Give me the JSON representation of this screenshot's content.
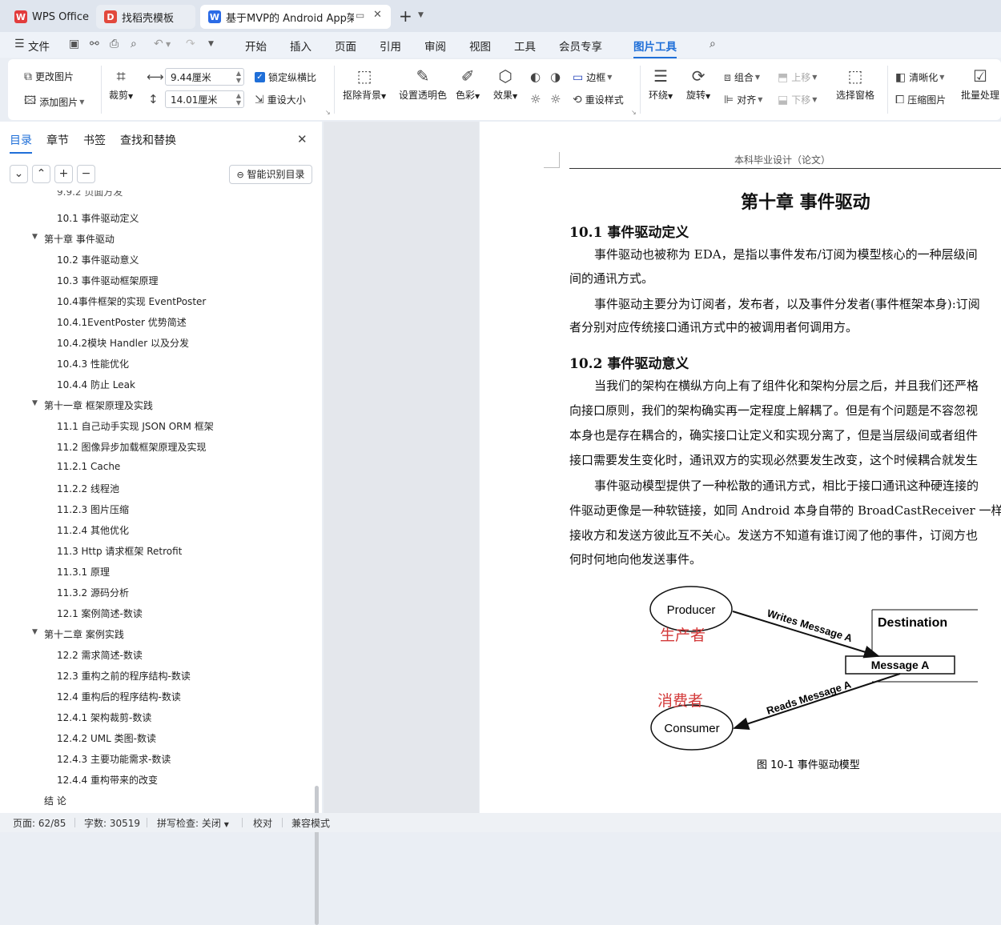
{
  "tabs": [
    {
      "label": "WPS Office",
      "icon": "W"
    },
    {
      "label": "找稻壳模板",
      "icon": "D"
    },
    {
      "label": "基于MVP的 Android App架构",
      "icon": "W"
    }
  ],
  "menu": {
    "file": "文件",
    "items": [
      "开始",
      "插入",
      "页面",
      "引用",
      "审阅",
      "视图",
      "工具",
      "会员专享",
      "图片工具"
    ]
  },
  "ribbon": {
    "change_picture": "更改图片",
    "add_picture": "添加图片",
    "crop": "裁剪",
    "width_value": "9.44厘米",
    "height_value": "14.01厘米",
    "lock_ratio": "锁定纵横比",
    "reset_size": "重设大小",
    "remove_bg": "抠除背景",
    "set_transparent": "设置透明色",
    "color": "色彩",
    "effect": "效果",
    "border": "边框",
    "reset_style": "重设样式",
    "wrap": "环绕",
    "rotate": "旋转",
    "group": "组合",
    "align": "对齐",
    "move_up": "上移",
    "move_down": "下移",
    "select_pane": "选择窗格",
    "sharpen": "清晰化",
    "compress": "压缩图片",
    "batch": "批量处理"
  },
  "sidebar": {
    "tabs": [
      "目录",
      "章节",
      "书签",
      "查找和替换"
    ],
    "smart_button": "智能识别目录",
    "partial": "9.9.2 页面方发",
    "items": [
      {
        "label": "10.1  事件驱动定义",
        "level": 2
      },
      {
        "label": "第十章  事件驱动",
        "level": 1
      },
      {
        "label": "10.2  事件驱动意义",
        "level": 2
      },
      {
        "label": "10.3  事件驱动框架原理",
        "level": 2
      },
      {
        "label": "10.4事件框架的实现 EventPoster",
        "level": 2
      },
      {
        "label": "10.4.1EventPoster 优势简述",
        "level": 2
      },
      {
        "label": "10.4.2模块 Handler 以及分发",
        "level": 2
      },
      {
        "label": "10.4.3 性能优化",
        "level": 2
      },
      {
        "label": "10.4.4  防止 Leak",
        "level": 2
      },
      {
        "label": "第十一章  框架原理及实践",
        "level": 1
      },
      {
        "label": "11.1   自己动手实现 JSON ORM   框架",
        "level": 2
      },
      {
        "label": "11.2   图像异步加载框架原理及实现",
        "level": 2
      },
      {
        "label": "11.2.1 Cache",
        "level": 2
      },
      {
        "label": "11.2.2   线程池",
        "level": 2
      },
      {
        "label": "11.2.3   图片压缩",
        "level": 2
      },
      {
        "label": "11.2.4   其他优化",
        "level": 2
      },
      {
        "label": "11.3 Http   请求框架 Retrofit",
        "level": 2
      },
      {
        "label": "11.3.1    原理",
        "level": 2
      },
      {
        "label": "11.3.2    源码分析",
        "level": 2
      },
      {
        "label": "12.1 案例简述-数读",
        "level": 2
      },
      {
        "label": "第十二章  案例实践",
        "level": 1
      },
      {
        "label": "12.2 需求简述-数读",
        "level": 2
      },
      {
        "label": "12.3 重构之前的程序结构-数读",
        "level": 2
      },
      {
        "label": "12.4 重构后的程序结构-数读",
        "level": 2
      },
      {
        "label": "12.4.1 架构裁剪-数读",
        "level": 2
      },
      {
        "label": "12.4.2 UML 类图-数读",
        "level": 2
      },
      {
        "label": "12.4.3 主要功能需求-数读",
        "level": 2
      },
      {
        "label": "12.4.4 重构带来的改变",
        "level": 2
      },
      {
        "label": "结  论",
        "level": 0
      }
    ]
  },
  "doc": {
    "header": "本科毕业设计（论文）",
    "chapter_title": "第十章  事件驱动",
    "sec1_title": "10.1  事件驱动定义",
    "p1_l1": "事件驱动也被称为  EDA，是指以事件发布/订阅为模型核心的一种层级间",
    "p1_l2": "间的通讯方式。",
    "p2_l1": "事件驱动主要分为订阅者，发布者，以及事件分发者(事件框架本身):订阅",
    "p2_l2": "者分别对应传统接口通讯方式中的被调用者何调用方。",
    "sec2_title": "10.2  事件驱动意义",
    "p3_l1": "当我们的架构在横纵方向上有了组件化和架构分层之后，并且我们还严格",
    "p3_l2": "向接口原则，我们的架构确实再一定程度上解耦了。但是有个问题是不容忽视",
    "p3_l3": "本身也是存在耦合的，确实接口让定义和实现分离了，但是当层级间或者组件",
    "p3_l4": "接口需要发生变化时，通讯双方的实现必然要发生改变，这个时候耦合就发生",
    "p4_l1": "事件驱动模型提供了一种松散的通讯方式，相比于接口通讯这种硬连接的",
    "p4_l2": "件驱动更像是一种软链接，如同   Android 本身自带的   BroadCastReceiver 一样",
    "p4_l3": "接收方和发送方彼此互不关心。发送方不知道有谁订阅了他的事件，订阅方也",
    "p4_l4": "何时何地向他发送事件。",
    "figure": {
      "producer": "Producer",
      "producer_cn": "生产者",
      "consumer": "Consumer",
      "consumer_cn": "消费者",
      "destination": "Destination",
      "message": "Message A",
      "writes": "Writes Message A",
      "reads": "Reads Message A",
      "caption": "图  10-1 事件驱动模型"
    }
  },
  "status": {
    "page": "页面: 62/85",
    "words": "字数: 30519",
    "spell": "拼写检查: 关闭",
    "proof": "校对",
    "compat": "兼容模式"
  },
  "colors": {
    "accent": "#1f6fd8",
    "wps_red": "#e23c3c",
    "figure_red": "#d33a3a"
  }
}
